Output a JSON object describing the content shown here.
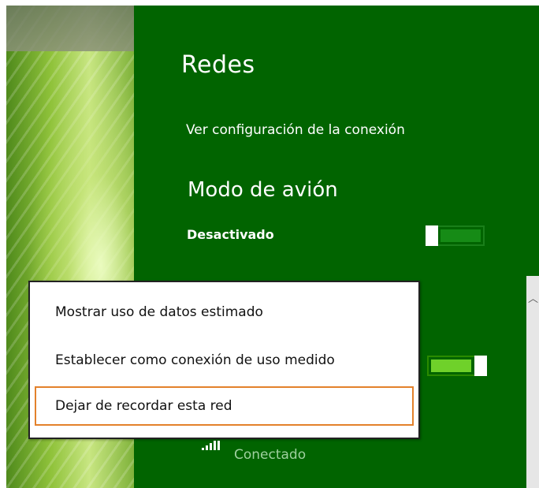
{
  "panel": {
    "title": "Redes",
    "connection_settings_link": "Ver configuración de la conexión",
    "airplane_mode": {
      "heading": "Modo de avión",
      "state_label": "Desactivado",
      "enabled": false
    },
    "wifi_toggle": {
      "enabled": true
    },
    "network": {
      "status": "Conectado",
      "signal_bars": 5,
      "signal_icon": "signal-bars-icon"
    }
  },
  "context_menu": {
    "items": [
      {
        "label": "Mostrar uso de datos estimado"
      },
      {
        "label": "Establecer como conexión de uso medido"
      },
      {
        "label": "Dejar de recordar esta red",
        "focused": true
      }
    ]
  },
  "colors": {
    "panel_bg": "#016400",
    "toggle_on": "#6fd12a",
    "toggle_off_track": "#168b16",
    "focus_outline": "#e3812b",
    "status_text": "#9fd09f"
  }
}
